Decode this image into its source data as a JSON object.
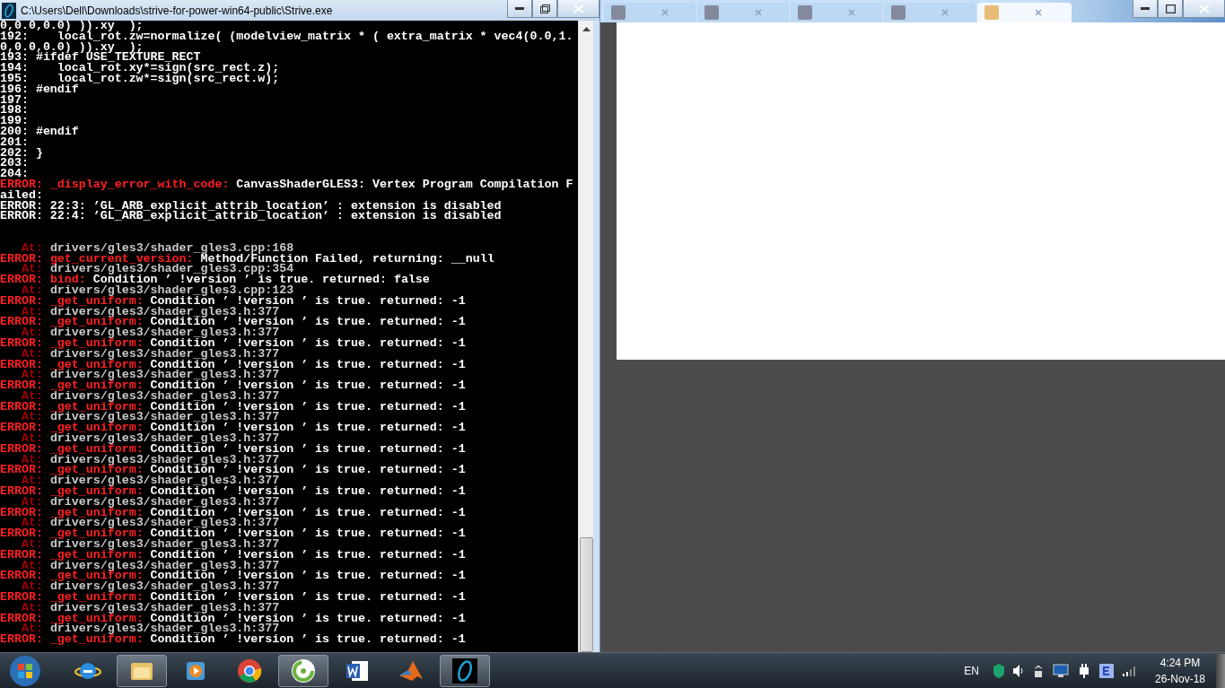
{
  "console": {
    "title": "C:\\Users\\Dell\\Downloads\\strive-for-power-win64-public\\Strive.exe",
    "lines": [
      {
        "kind": "code",
        "text": "0,0.0,0.0) )).xy  );"
      },
      {
        "kind": "code",
        "text": "192:    local_rot.zw=normalize( (modelview_matrix * ( extra_matrix * vec4(0.0,1."
      },
      {
        "kind": "code",
        "text": "0,0.0,0.0) )).xy  );"
      },
      {
        "kind": "code",
        "text": "193: #ifdef USE_TEXTURE_RECT"
      },
      {
        "kind": "code",
        "text": "194:    local_rot.xy*=sign(src_rect.z);"
      },
      {
        "kind": "code",
        "text": "195:    local_rot.zw*=sign(src_rect.w);"
      },
      {
        "kind": "code",
        "text": "196: #endif"
      },
      {
        "kind": "code",
        "text": "197:"
      },
      {
        "kind": "code",
        "text": "198:"
      },
      {
        "kind": "code",
        "text": "199:"
      },
      {
        "kind": "code",
        "text": "200: #endif"
      },
      {
        "kind": "code",
        "text": "201:"
      },
      {
        "kind": "code",
        "text": "202: }"
      },
      {
        "kind": "code",
        "text": "203:"
      },
      {
        "kind": "code",
        "text": "204:"
      },
      {
        "kind": "error",
        "label": "ERROR:",
        "source": "_display_error_with_code:",
        "message": "CanvasShaderGLES3: Vertex Program Compilation F"
      },
      {
        "kind": "code",
        "text": "ailed:"
      },
      {
        "kind": "code",
        "text": "ERROR: 22:3: ’GL_ARB_explicit_attrib_location’ : extension is disabled"
      },
      {
        "kind": "code",
        "text": "ERROR: 22:4: ’GL_ARB_explicit_attrib_location’ : extension is disabled"
      },
      {
        "kind": "blank"
      },
      {
        "kind": "blank"
      },
      {
        "kind": "at",
        "label": "At:",
        "path": "drivers/gles3/shader_gles3.cpp:168"
      },
      {
        "kind": "error",
        "label": "ERROR:",
        "source": "get_current_version:",
        "message": "Method/Function Failed, returning: __null"
      },
      {
        "kind": "at",
        "label": "At:",
        "path": "drivers/gles3/shader_gles3.cpp:354"
      },
      {
        "kind": "error",
        "label": "ERROR:",
        "source": "bind:",
        "message": "Condition ’ !version ’ is true. returned: false"
      },
      {
        "kind": "at",
        "label": "At:",
        "path": "drivers/gles3/shader_gles3.cpp:123"
      },
      {
        "kind": "error",
        "label": "ERROR:",
        "source": "_get_uniform:",
        "message": "Condition ’ !version ’ is true. returned: -1"
      },
      {
        "kind": "at",
        "label": "At:",
        "path": "drivers/gles3/shader_gles3.h:377"
      },
      {
        "kind": "error",
        "label": "ERROR:",
        "source": "_get_uniform:",
        "message": "Condition ’ !version ’ is true. returned: -1"
      },
      {
        "kind": "at",
        "label": "At:",
        "path": "drivers/gles3/shader_gles3.h:377"
      },
      {
        "kind": "error",
        "label": "ERROR:",
        "source": "_get_uniform:",
        "message": "Condition ’ !version ’ is true. returned: -1"
      },
      {
        "kind": "at",
        "label": "At:",
        "path": "drivers/gles3/shader_gles3.h:377"
      },
      {
        "kind": "error",
        "label": "ERROR:",
        "source": "_get_uniform:",
        "message": "Condition ’ !version ’ is true. returned: -1"
      },
      {
        "kind": "at",
        "label": "At:",
        "path": "drivers/gles3/shader_gles3.h:377"
      },
      {
        "kind": "error",
        "label": "ERROR:",
        "source": "_get_uniform:",
        "message": "Condition ’ !version ’ is true. returned: -1"
      },
      {
        "kind": "at",
        "label": "At:",
        "path": "drivers/gles3/shader_gles3.h:377"
      },
      {
        "kind": "error",
        "label": "ERROR:",
        "source": "_get_uniform:",
        "message": "Condition ’ !version ’ is true. returned: -1"
      },
      {
        "kind": "at",
        "label": "At:",
        "path": "drivers/gles3/shader_gles3.h:377"
      },
      {
        "kind": "error",
        "label": "ERROR:",
        "source": "_get_uniform:",
        "message": "Condition ’ !version ’ is true. returned: -1"
      },
      {
        "kind": "at",
        "label": "At:",
        "path": "drivers/gles3/shader_gles3.h:377"
      },
      {
        "kind": "error",
        "label": "ERROR:",
        "source": "_get_uniform:",
        "message": "Condition ’ !version ’ is true. returned: -1"
      },
      {
        "kind": "at",
        "label": "At:",
        "path": "drivers/gles3/shader_gles3.h:377"
      },
      {
        "kind": "error",
        "label": "ERROR:",
        "source": "_get_uniform:",
        "message": "Condition ’ !version ’ is true. returned: -1"
      },
      {
        "kind": "at",
        "label": "At:",
        "path": "drivers/gles3/shader_gles3.h:377"
      },
      {
        "kind": "error",
        "label": "ERROR:",
        "source": "_get_uniform:",
        "message": "Condition ’ !version ’ is true. returned: -1"
      },
      {
        "kind": "at",
        "label": "At:",
        "path": "drivers/gles3/shader_gles3.h:377"
      },
      {
        "kind": "error",
        "label": "ERROR:",
        "source": "_get_uniform:",
        "message": "Condition ’ !version ’ is true. returned: -1"
      },
      {
        "kind": "at",
        "label": "At:",
        "path": "drivers/gles3/shader_gles3.h:377"
      },
      {
        "kind": "error",
        "label": "ERROR:",
        "source": "_get_uniform:",
        "message": "Condition ’ !version ’ is true. returned: -1"
      },
      {
        "kind": "at",
        "label": "At:",
        "path": "drivers/gles3/shader_gles3.h:377"
      },
      {
        "kind": "error",
        "label": "ERROR:",
        "source": "_get_uniform:",
        "message": "Condition ’ !version ’ is true. returned: -1"
      },
      {
        "kind": "at",
        "label": "At:",
        "path": "drivers/gles3/shader_gles3.h:377"
      },
      {
        "kind": "error",
        "label": "ERROR:",
        "source": "_get_uniform:",
        "message": "Condition ’ !version ’ is true. returned: -1"
      },
      {
        "kind": "at",
        "label": "At:",
        "path": "drivers/gles3/shader_gles3.h:377"
      },
      {
        "kind": "error",
        "label": "ERROR:",
        "source": "_get_uniform:",
        "message": "Condition ’ !version ’ is true. returned: -1"
      },
      {
        "kind": "at",
        "label": "At:",
        "path": "drivers/gles3/shader_gles3.h:377"
      },
      {
        "kind": "error",
        "label": "ERROR:",
        "source": "_get_uniform:",
        "message": "Condition ’ !version ’ is true. returned: -1"
      },
      {
        "kind": "at",
        "label": "At:",
        "path": "drivers/gles3/shader_gles3.h:377"
      },
      {
        "kind": "error",
        "label": "ERROR:",
        "source": "_get_uniform:",
        "message": "Condition ’ !version ’ is true. returned: -1"
      }
    ]
  },
  "browser": {
    "tabs": [
      {
        "selected": false
      },
      {
        "selected": false
      },
      {
        "selected": false
      },
      {
        "selected": false
      },
      {
        "selected": true
      }
    ]
  },
  "taskbar": {
    "apps": [
      {
        "kind": "ie",
        "active": false
      },
      {
        "kind": "folder",
        "active": true
      },
      {
        "kind": "player",
        "active": false
      },
      {
        "kind": "chrome",
        "active": false
      },
      {
        "kind": "green",
        "active": true
      },
      {
        "kind": "word",
        "active": false
      },
      {
        "kind": "matlab",
        "active": false
      },
      {
        "kind": "game",
        "active": true
      }
    ],
    "language": "EN",
    "time": "4:24 PM",
    "date": "26-Nov-18"
  }
}
